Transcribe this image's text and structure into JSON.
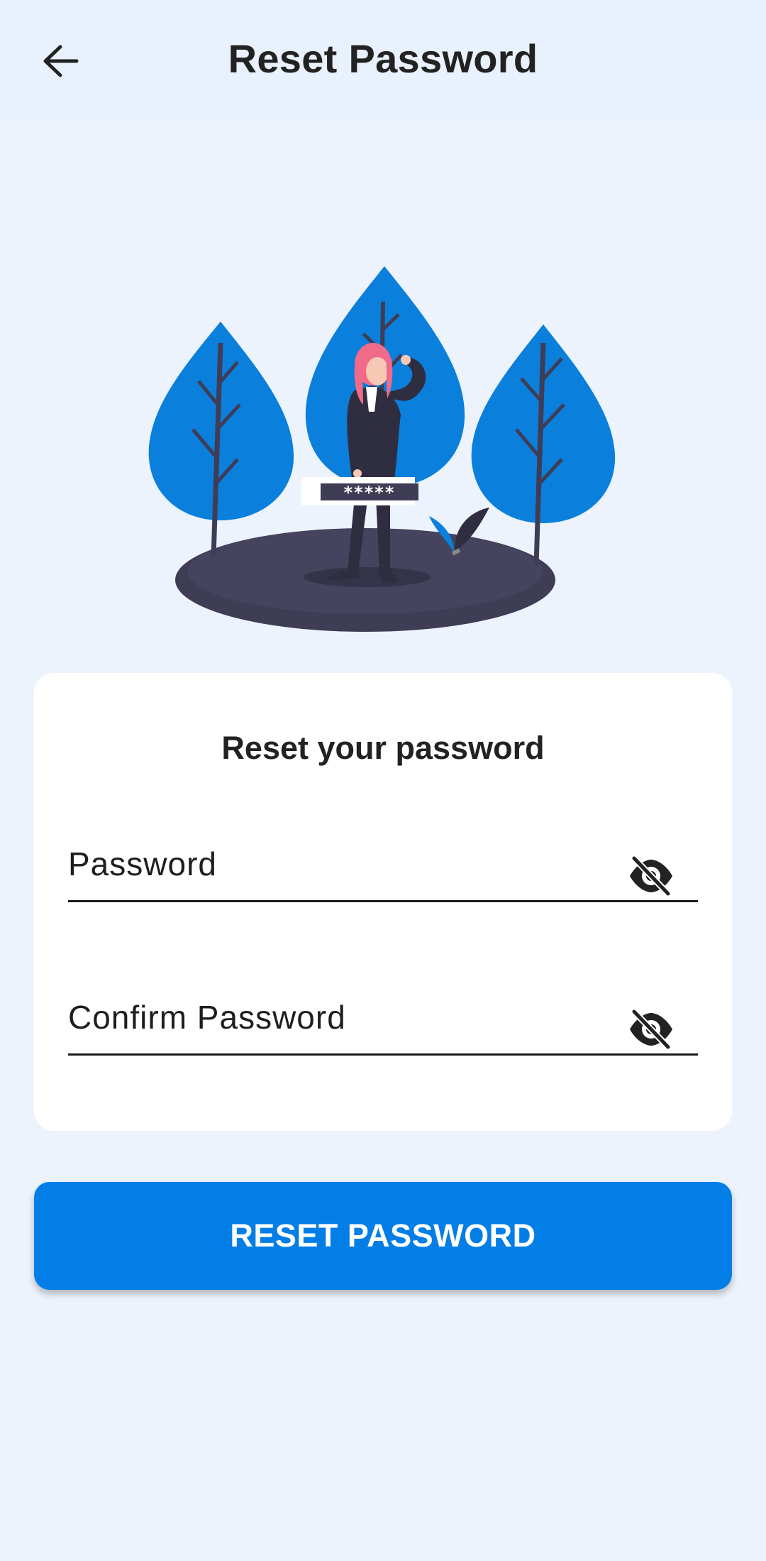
{
  "app_bar": {
    "title": "Reset Password",
    "back_icon": "arrow-left-icon"
  },
  "illustration": {
    "password_mask": "*****",
    "colors": {
      "tree": "#0b7fdc",
      "ground": "#3f3d56",
      "hair": "#f06a8a",
      "suit": "#2f2e41"
    }
  },
  "card": {
    "title": "Reset your password",
    "fields": [
      {
        "label": "Password",
        "value": "",
        "icon": "eye-off-icon"
      },
      {
        "label": "Confirm Password",
        "value": "",
        "icon": "eye-off-icon"
      }
    ]
  },
  "reset_button": {
    "label": "RESET PASSWORD"
  },
  "colors": {
    "background": "#ecf3fd",
    "app_bar": "#e9f1fc",
    "primary": "#037ee6",
    "card": "#ffffff",
    "text": "#222222"
  }
}
